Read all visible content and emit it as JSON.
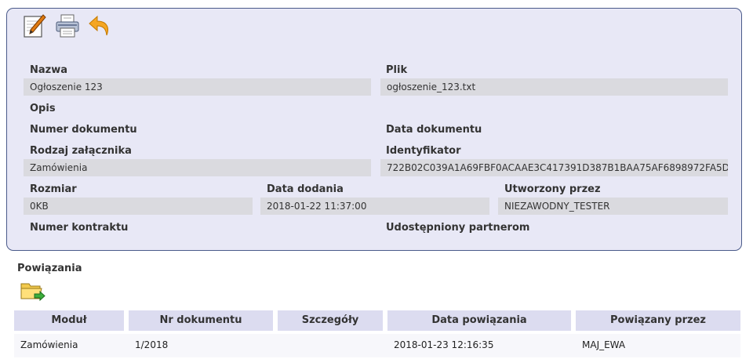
{
  "toolbar": {
    "icons": [
      "edit-icon",
      "print-icon",
      "back-arrow-icon"
    ]
  },
  "fields": {
    "nazwa": {
      "label": "Nazwa",
      "value": "Ogłoszenie 123"
    },
    "plik": {
      "label": "Plik",
      "value": "ogłoszenie_123.txt"
    },
    "opis": {
      "label": "Opis"
    },
    "numer_dokumentu": {
      "label": "Numer dokumentu"
    },
    "data_dokumentu": {
      "label": "Data dokumentu"
    },
    "rodzaj_zalacznika": {
      "label": "Rodzaj załącznika",
      "value": "Zamówienia"
    },
    "identyfikator": {
      "label": "Identyfikator",
      "value": "722B02C039A1A69FBF0ACAAE3C417391D387B1BAA75AF6898972FA5D..."
    },
    "rozmiar": {
      "label": "Rozmiar",
      "value": "0KB"
    },
    "data_dodania": {
      "label": "Data dodania",
      "value": "2018-01-22 11:37:00"
    },
    "utworzony_przez": {
      "label": "Utworzony przez",
      "value": "NIEZAWODNY_TESTER"
    },
    "numer_kontraktu": {
      "label": "Numer kontraktu"
    },
    "udostepniony_partnerom": {
      "label": "Udostępniony partnerom"
    }
  },
  "relations": {
    "title": "Powiązania",
    "icon": "folder-link-icon",
    "columns": [
      "Moduł",
      "Nr dokumentu",
      "Szczegóły",
      "Data powiązania",
      "Powiązany przez"
    ],
    "rows": [
      [
        "Zamówienia",
        "1/2018",
        "",
        "2018-01-23 12:16:35",
        "MAJ_EWA"
      ]
    ]
  }
}
